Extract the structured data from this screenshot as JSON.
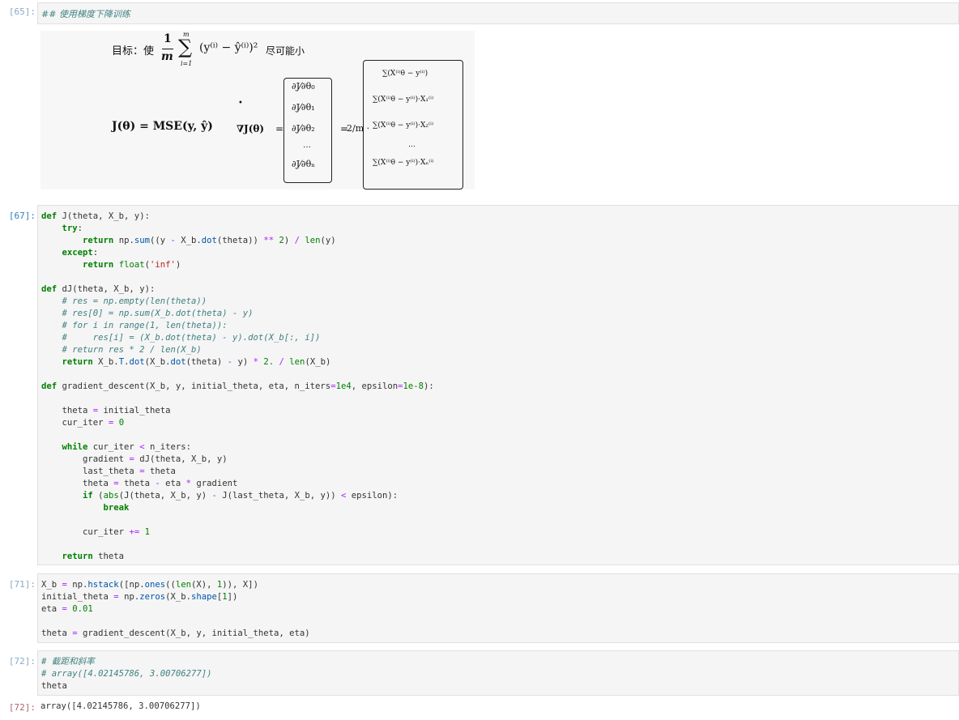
{
  "cells": {
    "md": {
      "prompt": "[65]:",
      "heading": "## 使用梯度下降训练",
      "formula": {
        "goal_label": "目标：使",
        "goal_frac_num": "1",
        "goal_frac_den": "m",
        "goal_sum_top": "m",
        "goal_sum_bot": "i=1",
        "goal_expr": "(y⁽ⁱ⁾ − ŷ⁽ⁱ⁾)²",
        "goal_suffix": "尽可能小",
        "j_def": "J(θ) = MSE(y, ŷ)",
        "grad": "∇J(θ)",
        "eq1": "=",
        "partials": [
          "∂J⁄∂θ₀",
          "∂J⁄∂θ₁",
          "∂J⁄∂θ₂",
          "…",
          "∂J⁄∂θₙ"
        ],
        "eq2": "=",
        "coef": "2/m ·",
        "sums": [
          "∑(X⁽ⁱ⁾θ − y⁽ⁱ⁾)",
          "∑(X⁽ⁱ⁾θ − y⁽ⁱ⁾)·X₁⁽ⁱ⁾",
          "∑(X⁽ⁱ⁾θ − y⁽ⁱ⁾)·X₂⁽ⁱ⁾",
          "…",
          "∑(X⁽ⁱ⁾θ − y⁽ⁱ⁾)·Xₙ⁽ⁱ⁾"
        ]
      }
    },
    "code1": {
      "prompt": "[67]:",
      "lines": [
        "def J(theta, X_b, y):",
        "    try:",
        "        return np.sum((y - X_b.dot(theta)) ** 2) / len(y)",
        "    except:",
        "        return float('inf')",
        "",
        "def dJ(theta, X_b, y):",
        "    # res = np.empty(len(theta))",
        "    # res[0] = np.sum(X_b.dot(theta) - y)",
        "    # for i in range(1, len(theta)):",
        "    #     res[i] = (X_b.dot(theta) - y).dot(X_b[:, i])",
        "    # return res * 2 / len(X_b)",
        "    return X_b.T.dot(X_b.dot(theta) - y) * 2. / len(X_b)",
        "",
        "def gradient_descent(X_b, y, initial_theta, eta, n_iters=1e4, epsilon=1e-8):",
        "",
        "    theta = initial_theta",
        "    cur_iter = 0",
        "",
        "    while cur_iter < n_iters:",
        "        gradient = dJ(theta, X_b, y)",
        "        last_theta = theta",
        "        theta = theta - eta * gradient",
        "        if (abs(J(theta, X_b, y) - J(last_theta, X_b, y)) < epsilon):",
        "            break",
        "",
        "        cur_iter += 1",
        "",
        "    return theta"
      ]
    },
    "code2": {
      "prompt": "[71]:",
      "lines": [
        "X_b = np.hstack([np.ones((len(X), 1)), X])",
        "initial_theta = np.zeros(X_b.shape[1])",
        "eta = 0.01",
        "",
        "theta = gradient_descent(X_b, y, initial_theta, eta)"
      ]
    },
    "code3": {
      "prompt": "[72]:",
      "lines": [
        "# 截距和斜率",
        "# array([4.02145786, 3.00706277])",
        "theta"
      ]
    },
    "output": {
      "prompt": "[72]:",
      "text": "array([4.02145786, 3.00706277])"
    }
  },
  "colors": {
    "prompt_in": "#307fc1",
    "prompt_out": "#b3646c",
    "keyword": "#008000",
    "comment": "#408080",
    "builtin_fn": "#0000ff",
    "string": "#ba2121",
    "cell_bg": "#f5f5f5"
  }
}
